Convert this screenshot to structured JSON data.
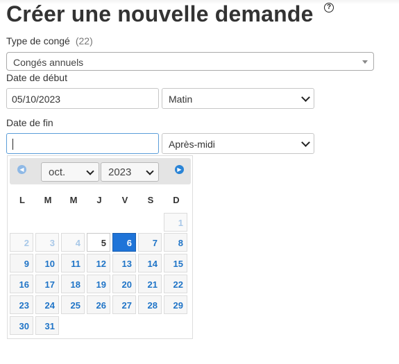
{
  "page": {
    "title": "Créer une nouvelle demande"
  },
  "leave_type": {
    "label": "Type de congé",
    "count": "(22)",
    "value": "Congés annuels"
  },
  "start": {
    "label": "Date de début",
    "date_value": "05/10/2023",
    "period_value": "Matin"
  },
  "end": {
    "label": "Date de fin",
    "date_value": "",
    "period_value": "Après-midi"
  },
  "datepicker": {
    "month": "oct.",
    "year": "2023",
    "weekdays": [
      "L",
      "M",
      "M",
      "J",
      "V",
      "S",
      "D"
    ],
    "prev_label": "◀",
    "next_label": "▶",
    "days": [
      {
        "d": "1",
        "kind": "other"
      },
      {
        "d": "2",
        "kind": "other"
      },
      {
        "d": "3",
        "kind": "other"
      },
      {
        "d": "4",
        "kind": "other"
      },
      {
        "d": "5",
        "kind": "today"
      },
      {
        "d": "6",
        "kind": "selected"
      },
      {
        "d": "7",
        "kind": "normal"
      },
      {
        "d": "8",
        "kind": "normal"
      },
      {
        "d": "9",
        "kind": "normal"
      },
      {
        "d": "10",
        "kind": "normal"
      },
      {
        "d": "11",
        "kind": "normal"
      },
      {
        "d": "12",
        "kind": "normal"
      },
      {
        "d": "13",
        "kind": "normal"
      },
      {
        "d": "14",
        "kind": "normal"
      },
      {
        "d": "15",
        "kind": "normal"
      },
      {
        "d": "16",
        "kind": "normal"
      },
      {
        "d": "17",
        "kind": "normal"
      },
      {
        "d": "18",
        "kind": "normal"
      },
      {
        "d": "19",
        "kind": "normal"
      },
      {
        "d": "20",
        "kind": "normal"
      },
      {
        "d": "21",
        "kind": "normal"
      },
      {
        "d": "22",
        "kind": "normal"
      },
      {
        "d": "23",
        "kind": "normal"
      },
      {
        "d": "24",
        "kind": "normal"
      },
      {
        "d": "25",
        "kind": "normal"
      },
      {
        "d": "26",
        "kind": "normal"
      },
      {
        "d": "27",
        "kind": "normal"
      },
      {
        "d": "28",
        "kind": "normal"
      },
      {
        "d": "29",
        "kind": "normal"
      },
      {
        "d": "30",
        "kind": "normal"
      },
      {
        "d": "31",
        "kind": "normal"
      }
    ]
  },
  "colors": {
    "accent": "#1f74d8",
    "link_day": "#1f74c7",
    "focus_border": "#5b9dd9"
  },
  "icons": {
    "help": "help-circle-icon",
    "prev": "prev-month-icon",
    "next": "next-month-icon"
  }
}
